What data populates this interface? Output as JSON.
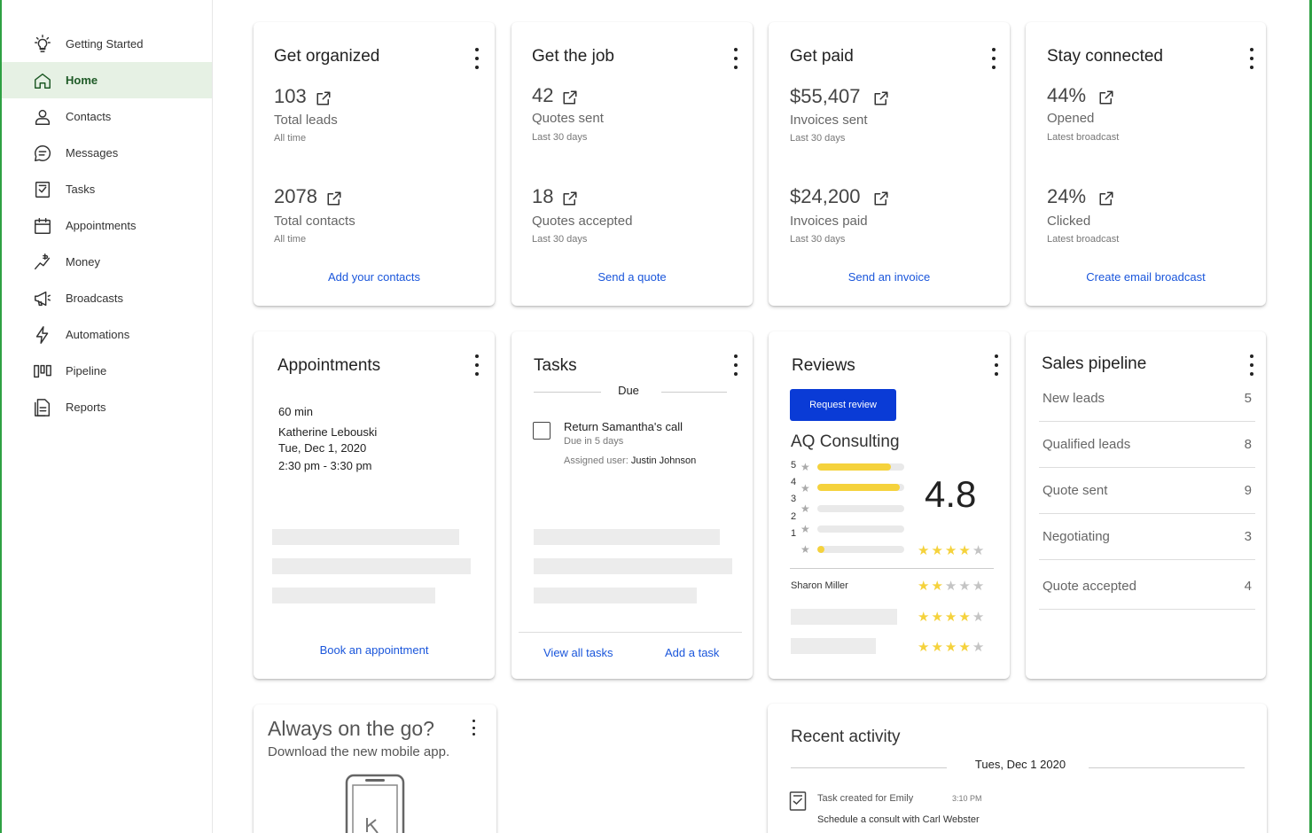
{
  "sidebar": {
    "items": [
      {
        "label": "Getting Started",
        "icon": "lightbulb-icon"
      },
      {
        "label": "Home",
        "icon": "home-icon"
      },
      {
        "label": "Contacts",
        "icon": "person-icon"
      },
      {
        "label": "Messages",
        "icon": "chat-icon"
      },
      {
        "label": "Tasks",
        "icon": "clipboard-check-icon"
      },
      {
        "label": "Appointments",
        "icon": "calendar-icon"
      },
      {
        "label": "Money",
        "icon": "money-icon"
      },
      {
        "label": "Broadcasts",
        "icon": "megaphone-icon"
      },
      {
        "label": "Automations",
        "icon": "lightning-icon"
      },
      {
        "label": "Pipeline",
        "icon": "pipeline-icon"
      },
      {
        "label": "Reports",
        "icon": "report-icon"
      }
    ],
    "active": "Home",
    "accent": "#e6f1e4"
  },
  "organized": {
    "title": "Get organized",
    "stat1": {
      "value": "103",
      "label": "Total leads",
      "sub": "All time"
    },
    "stat2": {
      "value": "2078",
      "label": "Total contacts",
      "sub": "All time"
    },
    "link": "Add your contacts"
  },
  "job": {
    "title": "Get the job",
    "stat1": {
      "value": "42",
      "label": "Quotes sent",
      "sub": "Last 30 days"
    },
    "stat2": {
      "value": "18",
      "label": "Quotes accepted",
      "sub": "Last 30 days"
    },
    "link": "Send a quote"
  },
  "paid": {
    "title": "Get paid",
    "stat1": {
      "value": "$55,407",
      "label": "Invoices sent",
      "sub": "Last 30 days"
    },
    "stat2": {
      "value": "$24,200",
      "label": "Invoices paid",
      "sub": "Last 30 days"
    },
    "link": "Send an invoice"
  },
  "connected": {
    "title": "Stay connected",
    "stat1": {
      "value": "44%",
      "label": "Opened",
      "sub": "Latest broadcast"
    },
    "stat2": {
      "value": "24%",
      "label": "Clicked",
      "sub": "Latest broadcast"
    },
    "link": "Create email broadcast"
  },
  "appointments": {
    "title": "Appointments",
    "duration": "60 min",
    "name": "Katherine Lebouski",
    "date": "Tue, Dec 1, 2020",
    "time": "2:30 pm - 3:30 pm",
    "link": "Book an appointment"
  },
  "tasks": {
    "title": "Tasks",
    "section": "Due",
    "item": {
      "title": "Return Samantha's call",
      "due": "Due in 5 days",
      "assigned_label": "Assigned user:",
      "assigned_user": "Justin Johnson"
    },
    "view_all": "View all tasks",
    "add": "Add a task"
  },
  "reviews": {
    "title": "Reviews",
    "button": "Request review",
    "business": "AQ Consulting",
    "average": "4.8",
    "breakdown": [
      {
        "label": "5",
        "fraction": 0.85
      },
      {
        "label": "4",
        "fraction": 0.95
      },
      {
        "label": "3",
        "fraction": 0
      },
      {
        "label": "2",
        "fraction": 0
      },
      {
        "label": "1",
        "fraction": 0.08
      }
    ],
    "summary_stars": 4,
    "reviews": [
      {
        "author": "Sharon Miller",
        "stars": 2
      },
      {
        "author": "",
        "stars": 4
      },
      {
        "author": "",
        "stars": 4
      }
    ],
    "button_color": "#0a3bd6",
    "star_color": "#f5d23c"
  },
  "pipeline": {
    "title": "Sales pipeline",
    "rows": [
      {
        "label": "New leads",
        "count": "5"
      },
      {
        "label": "Qualified leads",
        "count": "8"
      },
      {
        "label": "Quote sent",
        "count": "9"
      },
      {
        "label": "Negotiating",
        "count": "3"
      },
      {
        "label": "Quote accepted",
        "count": "4"
      }
    ]
  },
  "mobile": {
    "title": "Always on the go?",
    "subtitle": "Download the new mobile app."
  },
  "activity": {
    "title": "Recent activity",
    "date": "Tues, Dec 1 2020",
    "item": {
      "title": "Task created for Emily",
      "time": "3:10 PM",
      "detail": "Schedule a consult with Carl Webster"
    }
  }
}
